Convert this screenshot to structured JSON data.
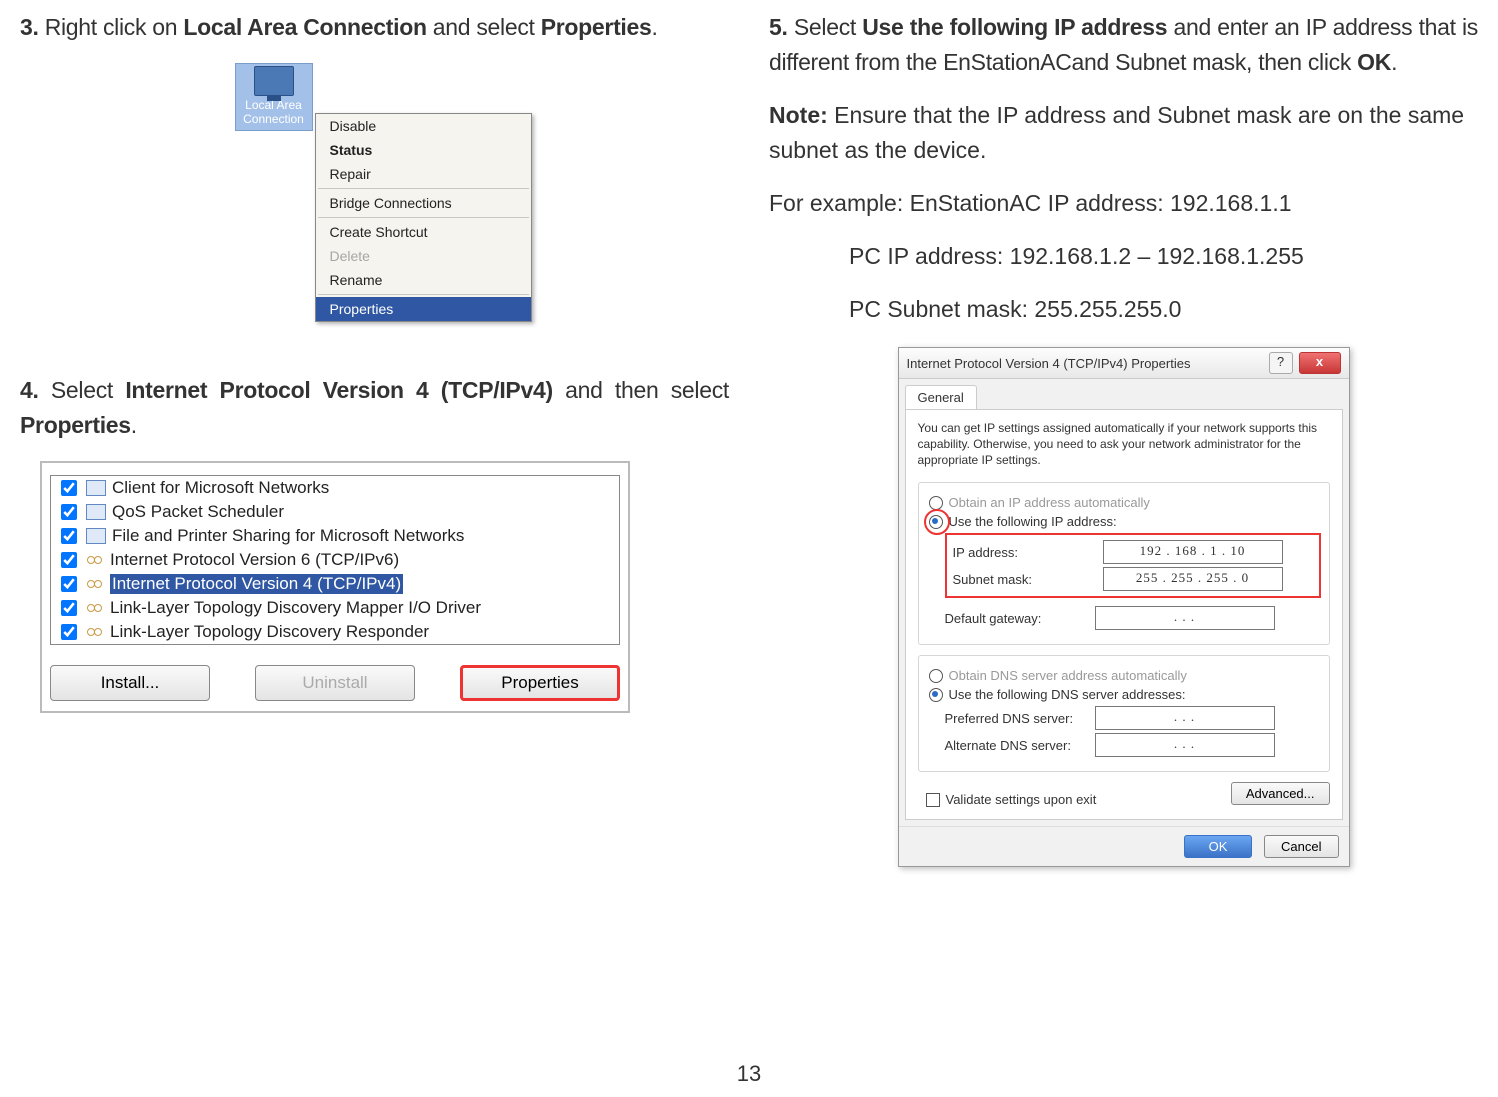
{
  "page_number": "13",
  "left": {
    "step3": {
      "num": "3.",
      "t1": "Right click on ",
      "b1": "Local Area Connection",
      "t2": " and select ",
      "b2": "Properties",
      "t3": "."
    },
    "step4": {
      "num": "4.",
      "t1": "Select ",
      "b1": "Internet Protocol Version 4 (TCP/IPv4)",
      "t2": " and then select ",
      "b2": "Properties",
      "t3": "."
    },
    "fig1": {
      "icon_label": "Local Area Connection",
      "menu": {
        "disable": "Disable",
        "status": "Status",
        "repair": "Repair",
        "bridge": "Bridge Connections",
        "shortcut": "Create Shortcut",
        "delete": "Delete",
        "rename": "Rename",
        "properties": "Properties"
      }
    },
    "fig2": {
      "items": {
        "i0": "Client for Microsoft Networks",
        "i1": "QoS Packet Scheduler",
        "i2": "File and Printer Sharing for Microsoft Networks",
        "i3": "Internet Protocol Version 6 (TCP/IPv6)",
        "i4": "Internet Protocol Version 4 (TCP/IPv4)",
        "i5": "Link-Layer Topology Discovery Mapper I/O Driver",
        "i6": "Link-Layer Topology Discovery Responder"
      },
      "btn_install": "Install...",
      "btn_uninstall": "Uninstall",
      "btn_properties": "Properties"
    }
  },
  "right": {
    "step5": {
      "num": "5.",
      "t1": "Select ",
      "b1": "Use the following IP address",
      "t2": " and enter an IP address that is different from the EnStationACand Subnet mask, then click ",
      "b2": "OK",
      "t3": "."
    },
    "note_label": "Note:",
    "note_body": " Ensure that the IP address and Subnet mask are on the same subnet as the device.",
    "example_line": "For example: EnStationAC IP address: 192.168.1.1",
    "pc_ip": "PC IP address: 192.168.1.2 – 192.168.1.255",
    "pc_subnet": "PC Subnet mask: 255.255.255.0",
    "fig3": {
      "title": "Internet Protocol Version 4 (TCP/IPv4) Properties",
      "help": "?",
      "close": "x",
      "tab": "General",
      "desc": "You can get IP settings assigned automatically if your network supports this capability. Otherwise, you need to ask your network administrator for the appropriate IP settings.",
      "r_auto_ip": "Obtain an IP address automatically",
      "r_use_ip": "Use the following IP address:",
      "l_ip": "IP address:",
      "v_ip": "192 . 168 .  1  .  10",
      "l_mask": "Subnet mask:",
      "v_mask": "255 . 255 . 255 .  0",
      "l_gw": "Default gateway:",
      "v_gw": ".       .       .",
      "r_auto_dns": "Obtain DNS server address automatically",
      "r_use_dns": "Use the following DNS server addresses:",
      "l_pdns": "Preferred DNS server:",
      "v_pdns": ".       .       .",
      "l_adns": "Alternate DNS server:",
      "v_adns": ".       .       .",
      "validate": "Validate settings upon exit",
      "advanced": "Advanced...",
      "ok": "OK",
      "cancel": "Cancel"
    }
  }
}
